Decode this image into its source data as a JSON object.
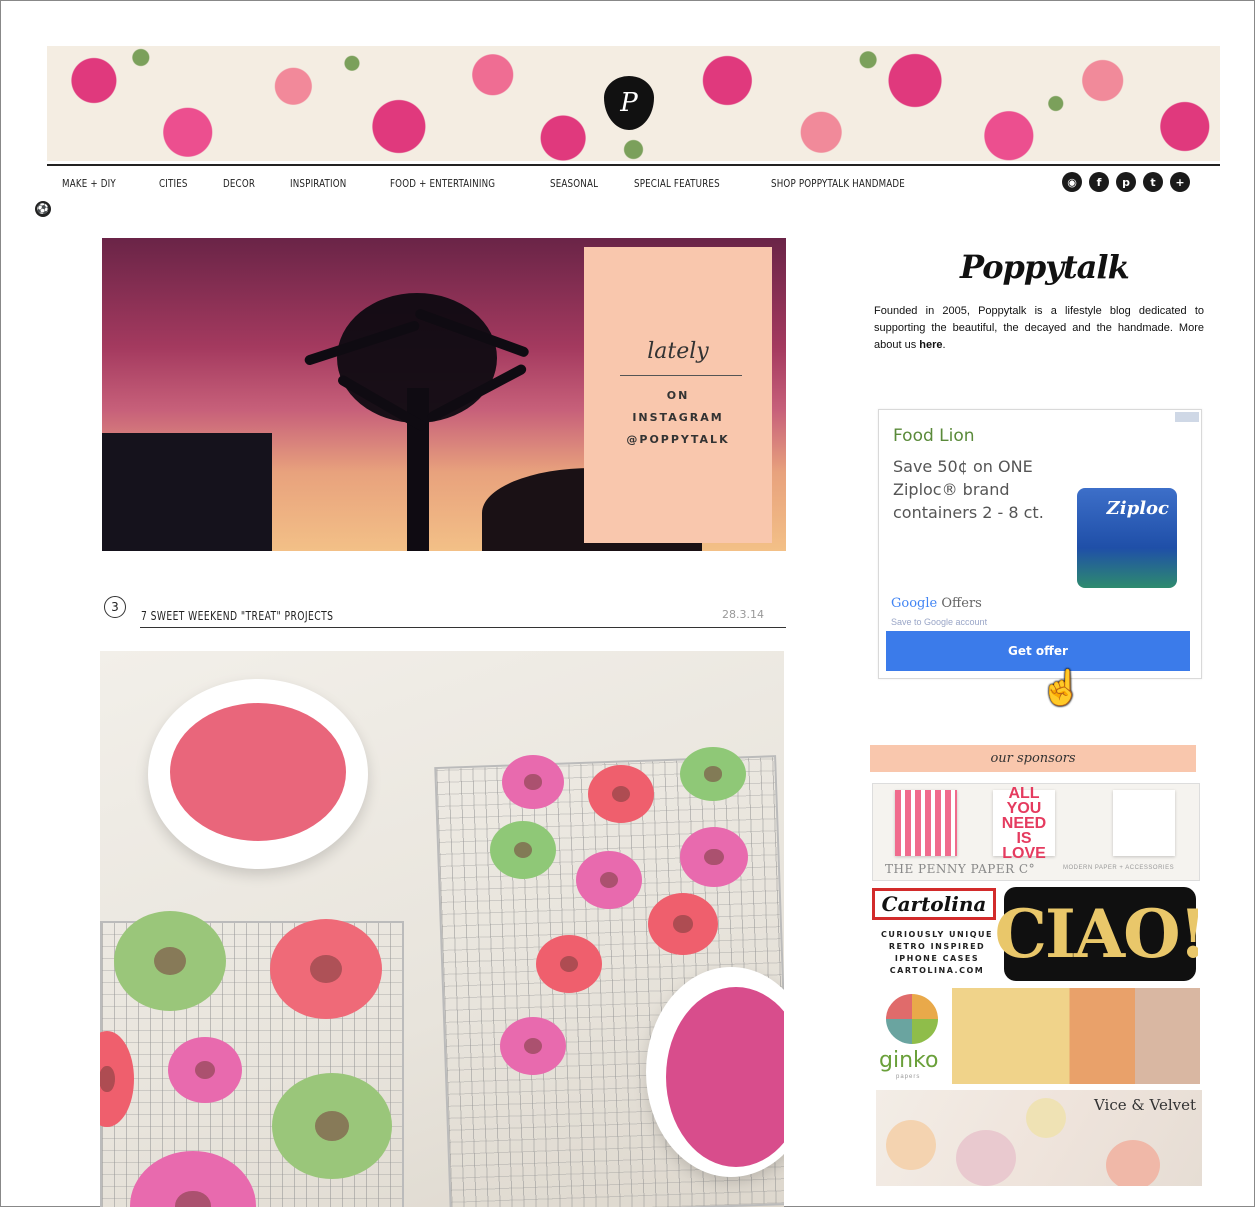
{
  "brand": {
    "logo_letter": "P",
    "name": "Poppytalk",
    "about_text": "Founded in 2005, Poppytalk is a lifestyle blog dedicated to supporting the beautiful, the decayed and the handmade. More about us ",
    "about_link": "here",
    "about_end": "."
  },
  "nav": {
    "items": [
      {
        "label": "MAKE + DIY"
      },
      {
        "label": "CITIES"
      },
      {
        "label": "DECOR"
      },
      {
        "label": "INSPIRATION"
      },
      {
        "label": "FOOD + ENTERTAINING"
      },
      {
        "label": "SEASONAL"
      },
      {
        "label": "SPECIAL FEATURES"
      },
      {
        "label": "SHOP POPPYTALK HANDMADE"
      }
    ],
    "social": [
      {
        "icon": "rss-icon",
        "glyph": "◉"
      },
      {
        "icon": "facebook-icon",
        "glyph": "f"
      },
      {
        "icon": "pinterest-icon",
        "glyph": "p"
      },
      {
        "icon": "twitter-icon",
        "glyph": "t"
      },
      {
        "icon": "plus-icon",
        "glyph": "+"
      }
    ]
  },
  "hero": {
    "script": "lately",
    "line1": "ON",
    "line2": "INSTAGRAM",
    "line3": "@POPPYTALK"
  },
  "post": {
    "number": "3",
    "title": "7 SWEET WEEKEND \"TREAT\" PROJECTS",
    "date": "28.3.14"
  },
  "ad": {
    "advertiser": "Food Lion",
    "offer": "Save 50¢ on ONE Ziploc® brand containers 2 - 8 ct.",
    "product_label": "Ziploc",
    "google_offers_g": "Google",
    "google_offers_rest": " Offers",
    "save_text": "Save to Google account",
    "button": "Get offer"
  },
  "sponsors": {
    "heading": "our sponsors",
    "penny_card_text": "ALL YOU NEED IS LOVE",
    "penny_name": "THE PENNY PAPER C°",
    "penny_tag": "MODERN PAPER + ACCESSORIES",
    "cartolina_logo": "Cartolina",
    "cartolina_l1": "CURIOUSLY UNIQUE",
    "cartolina_l2": "RETRO INSPIRED",
    "cartolina_l3": "IPHONE CASES",
    "cartolina_l4": "CARTOLINA.COM",
    "cartolina_phone": "CIAO!",
    "ginko_name": "ginko",
    "ginko_sub": "papers",
    "vice_name": "Vice & Velvet"
  },
  "colors": {
    "accent_peach": "#f9c7ad",
    "button_blue": "#3b7bea",
    "ad_green": "#5a8a3a"
  }
}
